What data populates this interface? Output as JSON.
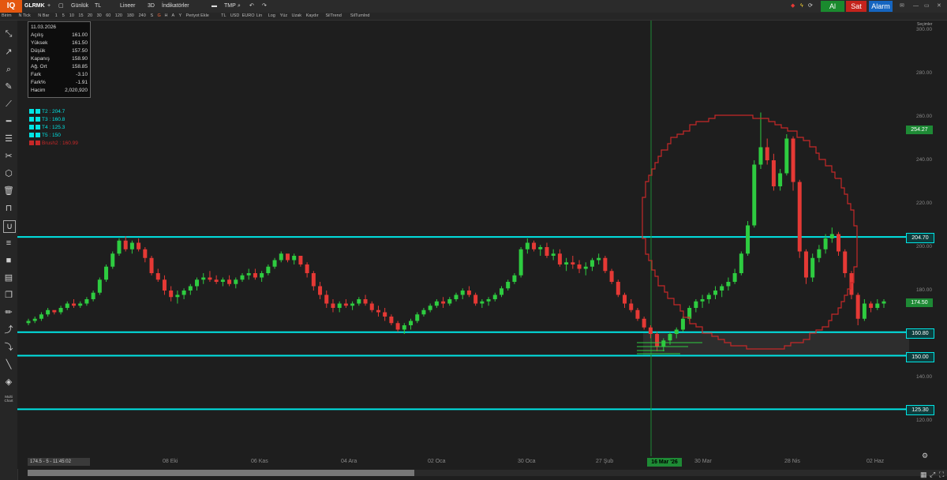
{
  "topbar": {
    "logo": "IQ",
    "symbol": "GLRMK",
    "plus": "+",
    "period": "Günlük",
    "currency": "TL",
    "scale": "Lineer",
    "view3d": "3D",
    "indicators": "İndikatörler",
    "template": "TMP",
    "buy": "Al",
    "sell": "Sat",
    "alarm": "Alarm"
  },
  "toolbar2": {
    "items": [
      "Birim",
      "N Tick",
      "N Bar",
      "1",
      "5",
      "10",
      "15",
      "20",
      "30",
      "60",
      "120",
      "180",
      "240",
      "S",
      "G",
      "H",
      "A",
      "Y",
      "Periyot Ekle",
      "TL",
      "USD",
      "EURO",
      "Lin",
      "Log",
      "Yüz",
      "Uzak",
      "Kaydır",
      "SilTrend",
      "SilTumInd"
    ]
  },
  "sidebar": {
    "multi_chart_label": "Multi Chart"
  },
  "info": {
    "date": "11.03.2026",
    "rows": [
      {
        "k": "Açılış",
        "v": "161.00"
      },
      {
        "k": "Yüksek",
        "v": "161.50"
      },
      {
        "k": "Düşük",
        "v": "157.50"
      },
      {
        "k": "Kapanış",
        "v": "158.90"
      },
      {
        "k": "Ağ. Ort",
        "v": "158.85"
      },
      {
        "k": "Fark",
        "v": "-3.10"
      },
      {
        "k": "Fark%",
        "v": "-1.91"
      },
      {
        "k": "Hacim",
        "v": "2,020,920"
      }
    ]
  },
  "legend": [
    {
      "label": "T2 : 204.7",
      "color": "#00e5e5"
    },
    {
      "label": "T3 : 160.8",
      "color": "#00e5e5"
    },
    {
      "label": "T4 : 125.3",
      "color": "#00e5e5"
    },
    {
      "label": "T5 : 150",
      "color": "#00e5e5"
    },
    {
      "label": "Brush2 : 160.99",
      "color": "#c62828"
    }
  ],
  "yaxis": {
    "header": "Seçimler",
    "ticks": [
      "300.00",
      "280.00",
      "260.00",
      "240.00",
      "220.00",
      "200.00",
      "180.00",
      "160.00",
      "140.00",
      "120.00"
    ],
    "tags": [
      {
        "label": "254.27",
        "color": "#1e8a35"
      },
      {
        "label": "204.70",
        "color": "#00bfbf"
      },
      {
        "label": "174.50",
        "color": "#1e8a35"
      },
      {
        "label": "160.80",
        "color": "#00bfbf"
      },
      {
        "label": "150.00",
        "color": "#00bfbf"
      },
      {
        "label": "125.30",
        "color": "#00bfbf"
      }
    ]
  },
  "xaxis": {
    "ticks": [
      "Eyl",
      "08 Eki",
      "06 Kas",
      "04 Ara",
      "02 Oca",
      "30 Oca",
      "27 Şub",
      "30 Mar",
      "28 Nis",
      "02 Haz"
    ],
    "cursor_date": "16 Mar '26"
  },
  "status": "174.5 - 5 - 11:45:02",
  "chart_data": {
    "type": "candlestick",
    "symbol": "GLRMK",
    "horizontal_levels": [
      204.7,
      160.8,
      150,
      125.3
    ],
    "ylim": [
      110,
      305
    ],
    "last_price": 174.5,
    "candles": [
      [
        165,
        167,
        164,
        166
      ],
      [
        166,
        168,
        165,
        167
      ],
      [
        167,
        170,
        166,
        169
      ],
      [
        169,
        172,
        168,
        171
      ],
      [
        171,
        170,
        169,
        170
      ],
      [
        170,
        173,
        169,
        172
      ],
      [
        172,
        175,
        171,
        174
      ],
      [
        174,
        176,
        172,
        173
      ],
      [
        173,
        175,
        172,
        174
      ],
      [
        174,
        177,
        173,
        176
      ],
      [
        176,
        180,
        175,
        179
      ],
      [
        179,
        186,
        178,
        185
      ],
      [
        185,
        192,
        184,
        191
      ],
      [
        191,
        198,
        190,
        197
      ],
      [
        197,
        204,
        196,
        203
      ],
      [
        203,
        205,
        198,
        199
      ],
      [
        199,
        203,
        197,
        202
      ],
      [
        202,
        204,
        198,
        199
      ],
      [
        199,
        200,
        193,
        195
      ],
      [
        195,
        196,
        187,
        188
      ],
      [
        188,
        190,
        184,
        185
      ],
      [
        185,
        187,
        178,
        180
      ],
      [
        180,
        182,
        175,
        177
      ],
      [
        177,
        180,
        174,
        178
      ],
      [
        178,
        181,
        176,
        180
      ],
      [
        180,
        183,
        178,
        182
      ],
      [
        182,
        186,
        180,
        185
      ],
      [
        185,
        188,
        183,
        186
      ],
      [
        186,
        189,
        184,
        185
      ],
      [
        185,
        187,
        183,
        184
      ],
      [
        184,
        186,
        182,
        185
      ],
      [
        185,
        187,
        182,
        183
      ],
      [
        183,
        186,
        181,
        185
      ],
      [
        185,
        188,
        184,
        187
      ],
      [
        187,
        190,
        185,
        188
      ],
      [
        188,
        190,
        185,
        186
      ],
      [
        186,
        189,
        184,
        188
      ],
      [
        188,
        192,
        187,
        191
      ],
      [
        191,
        195,
        190,
        194
      ],
      [
        194,
        198,
        193,
        197
      ],
      [
        197,
        196,
        193,
        194
      ],
      [
        194,
        197,
        192,
        196
      ],
      [
        196,
        195,
        191,
        192
      ],
      [
        192,
        193,
        186,
        188
      ],
      [
        188,
        189,
        180,
        182
      ],
      [
        182,
        184,
        176,
        178
      ],
      [
        178,
        180,
        172,
        174
      ],
      [
        174,
        176,
        170,
        172
      ],
      [
        172,
        175,
        170,
        174
      ],
      [
        174,
        176,
        172,
        173
      ],
      [
        173,
        175,
        171,
        174
      ],
      [
        174,
        177,
        173,
        176
      ],
      [
        176,
        178,
        173,
        174
      ],
      [
        174,
        175,
        170,
        171
      ],
      [
        171,
        173,
        168,
        170
      ],
      [
        170,
        172,
        166,
        168
      ],
      [
        168,
        169,
        164,
        165
      ],
      [
        165,
        166,
        161,
        162
      ],
      [
        162,
        165,
        160,
        164
      ],
      [
        164,
        167,
        162,
        166
      ],
      [
        166,
        170,
        165,
        169
      ],
      [
        169,
        172,
        168,
        171
      ],
      [
        171,
        174,
        170,
        173
      ],
      [
        173,
        176,
        172,
        175
      ],
      [
        175,
        177,
        172,
        174
      ],
      [
        174,
        177,
        173,
        176
      ],
      [
        176,
        179,
        175,
        178
      ],
      [
        178,
        181,
        176,
        180
      ],
      [
        180,
        182,
        177,
        178
      ],
      [
        178,
        179,
        173,
        174
      ],
      [
        174,
        176,
        172,
        175
      ],
      [
        175,
        177,
        173,
        176
      ],
      [
        176,
        179,
        175,
        178
      ],
      [
        178,
        182,
        177,
        181
      ],
      [
        181,
        185,
        180,
        184
      ],
      [
        184,
        188,
        183,
        187
      ],
      [
        187,
        200,
        186,
        199
      ],
      [
        199,
        204,
        197,
        202
      ],
      [
        202,
        203,
        198,
        199
      ],
      [
        199,
        201,
        196,
        200
      ],
      [
        200,
        202,
        195,
        196
      ],
      [
        196,
        199,
        194,
        197
      ],
      [
        197,
        199,
        191,
        192
      ],
      [
        192,
        195,
        189,
        193
      ],
      [
        193,
        196,
        190,
        192
      ],
      [
        192,
        194,
        188,
        190
      ],
      [
        190,
        193,
        187,
        191
      ],
      [
        191,
        195,
        189,
        194
      ],
      [
        194,
        197,
        192,
        195
      ],
      [
        195,
        196,
        188,
        189
      ],
      [
        189,
        190,
        183,
        184
      ],
      [
        184,
        185,
        177,
        178
      ],
      [
        178,
        179,
        172,
        174
      ],
      [
        174,
        176,
        170,
        171
      ],
      [
        171,
        172,
        166,
        167
      ],
      [
        167,
        168,
        162,
        163
      ],
      [
        163,
        164,
        158,
        160
      ],
      [
        160,
        161,
        152,
        154
      ],
      [
        154,
        158,
        152,
        157
      ],
      [
        157,
        161,
        155,
        160
      ],
      [
        160,
        163,
        158,
        162
      ],
      [
        162,
        168,
        161,
        167
      ],
      [
        167,
        173,
        166,
        172
      ],
      [
        172,
        176,
        170,
        175
      ],
      [
        175,
        178,
        172,
        176
      ],
      [
        176,
        179,
        174,
        178
      ],
      [
        178,
        182,
        176,
        180
      ],
      [
        180,
        183,
        177,
        182
      ],
      [
        182,
        186,
        180,
        184
      ],
      [
        184,
        190,
        183,
        188
      ],
      [
        188,
        198,
        187,
        197
      ],
      [
        197,
        212,
        196,
        210
      ],
      [
        210,
        240,
        209,
        238
      ],
      [
        238,
        262,
        236,
        246
      ],
      [
        246,
        250,
        238,
        240
      ],
      [
        240,
        243,
        226,
        228
      ],
      [
        228,
        236,
        226,
        234
      ],
      [
        234,
        252,
        233,
        250
      ],
      [
        250,
        251,
        226,
        230
      ],
      [
        230,
        231,
        195,
        198
      ],
      [
        198,
        199,
        183,
        186
      ],
      [
        186,
        197,
        184,
        195
      ],
      [
        195,
        201,
        193,
        199
      ],
      [
        199,
        206,
        197,
        204
      ],
      [
        204,
        209,
        202,
        206
      ],
      [
        206,
        207,
        196,
        198
      ],
      [
        198,
        199,
        186,
        188
      ],
      [
        188,
        189,
        176,
        178
      ],
      [
        178,
        179,
        164,
        167
      ],
      [
        167,
        176,
        166,
        174
      ],
      [
        174,
        175,
        170,
        172
      ],
      [
        172,
        176,
        171,
        174
      ],
      [
        174,
        176,
        172,
        175
      ]
    ]
  }
}
